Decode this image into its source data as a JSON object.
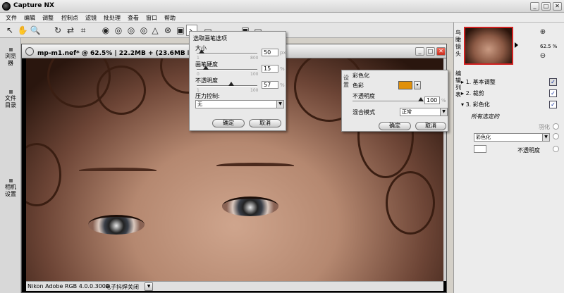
{
  "app": {
    "title": "Capture NX",
    "min": "_",
    "max": "□",
    "close": "✕"
  },
  "menu": [
    "文件",
    "编辑",
    "调整",
    "控制点",
    "滤镜",
    "批处理",
    "查看",
    "窗口",
    "帮助"
  ],
  "toolbar": {
    "tools": [
      "↖",
      "✋",
      "🔍",
      "↻",
      "⇄",
      "⌗",
      "◉",
      "◎",
      "◎",
      "◎",
      "△",
      "⊛",
      "▣",
      "↘",
      "▭",
      "▭",
      "▭",
      "▣",
      "▭"
    ]
  },
  "left_tabs": {
    "browser": "浏览器",
    "file_dir": "文件目录",
    "camera": "相机设置"
  },
  "image_window": {
    "title": "mp-m1.nef* @ 62.5% | 22.2MB + (23.6MB 临时缓存)",
    "colorspace": "Nikon Adobe RGB 4.0.0.3000",
    "shake": "电子抖焊关闭"
  },
  "brush_popup": {
    "title": "选取画笔选项",
    "size_label": "大小",
    "size_value": "50",
    "size_min": "1",
    "size_max": "800",
    "size_unit": "px",
    "hardness_label": "画笔硬度",
    "hardness_value": "15",
    "hardness_min": "0",
    "hardness_max": "100",
    "hardness_unit": "%",
    "opacity_label": "不透明度",
    "opacity_value": "57",
    "opacity_min": "1",
    "opacity_max": "100",
    "opacity_unit": "%",
    "pressure_label": "压力控制:",
    "pressure_value": "无",
    "ok": "确定",
    "cancel": "取消"
  },
  "colorize_popup": {
    "side_label": "设置",
    "title": "彩色化",
    "color_label": "色彩",
    "color_value": "#e0900a",
    "opacity_label": "不透明度",
    "opacity_value": "100",
    "opacity_unit": "%",
    "blend_label": "混合模式",
    "blend_value": "正常",
    "ok": "确定",
    "cancel": "取消"
  },
  "right_panel": {
    "lens_tab": "鸟瞰镜头",
    "zoom_value": "62.5 %",
    "edit_tab": "编辑列表",
    "steps": [
      {
        "label": "1. 基本调整",
        "checked": "✓"
      },
      {
        "label": "2. 裁剪",
        "checked": "✓"
      },
      {
        "label": "3. 彩色化",
        "checked": "✓"
      }
    ],
    "all_selected": "所有选定的",
    "feather": "羽化",
    "colorize_dd": "彩色化",
    "opacity_label": "不透明度"
  }
}
